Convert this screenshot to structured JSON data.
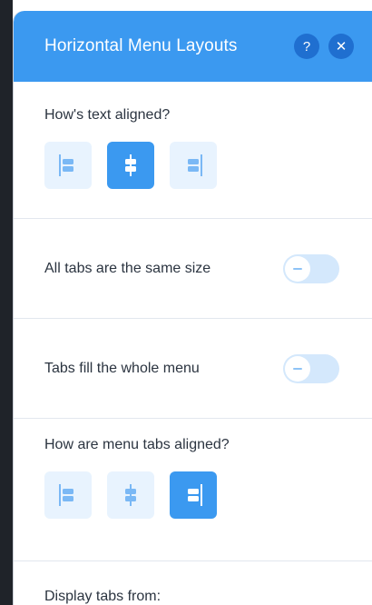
{
  "panel": {
    "title": "Horizontal Menu Layouts",
    "help_icon": "?",
    "close_icon": "✕"
  },
  "text_alignment": {
    "label": "How's text aligned?",
    "options": [
      "left",
      "center",
      "right"
    ],
    "selected": "center"
  },
  "same_size": {
    "label": "All tabs are the same size",
    "enabled": false
  },
  "fill_menu": {
    "label": "Tabs fill the whole menu",
    "enabled": false
  },
  "tab_alignment": {
    "label": "How are menu tabs aligned?",
    "options": [
      "left",
      "center",
      "right"
    ],
    "selected": "right"
  },
  "display_tabs": {
    "label": "Display tabs from:"
  },
  "colors": {
    "accent": "#3b99f0",
    "accent_dark": "#1f6fd0",
    "button_bg": "#e8f3fe"
  }
}
